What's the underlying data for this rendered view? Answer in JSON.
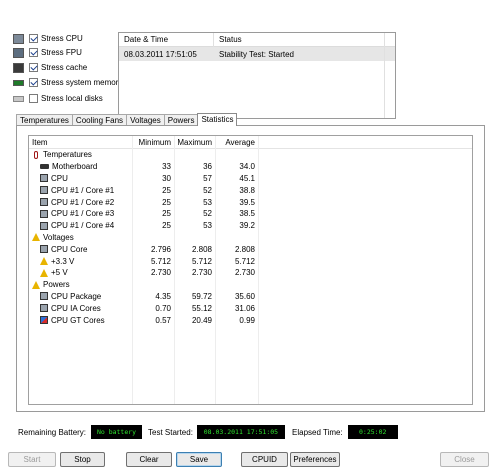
{
  "options": [
    {
      "icon": "cpu-chip-icon",
      "label": "Stress CPU",
      "checked": true
    },
    {
      "icon": "fpu-chip-icon",
      "label": "Stress FPU",
      "checked": true
    },
    {
      "icon": "cache-icon",
      "label": "Stress cache",
      "checked": true
    },
    {
      "icon": "memory-icon",
      "label": "Stress system memory",
      "checked": true
    },
    {
      "icon": "disk-icon",
      "label": "Stress local disks",
      "checked": false
    }
  ],
  "log": {
    "headers": {
      "datetime": "Date & Time",
      "status": "Status"
    },
    "rows": [
      {
        "datetime": "08.03.2011 17:51:05",
        "status": "Stability Test: Started"
      }
    ]
  },
  "tabs": [
    "Temperatures",
    "Cooling Fans",
    "Voltages",
    "Powers",
    "Statistics"
  ],
  "active_tab": "Statistics",
  "stats": {
    "headers": {
      "item": "Item",
      "min": "Minimum",
      "max": "Maximum",
      "avg": "Average"
    },
    "rows": [
      {
        "type": "group",
        "icon": "thermometer-icon",
        "label": "Temperatures"
      },
      {
        "type": "item",
        "icon": "motherboard-icon",
        "label": "Motherboard",
        "min": "33",
        "max": "36",
        "avg": "34.0"
      },
      {
        "type": "item",
        "icon": "cpu-chip-icon",
        "label": "CPU",
        "min": "30",
        "max": "57",
        "avg": "45.1"
      },
      {
        "type": "item",
        "icon": "cpu-chip-icon",
        "label": "CPU #1 / Core #1",
        "min": "25",
        "max": "52",
        "avg": "38.8"
      },
      {
        "type": "item",
        "icon": "cpu-chip-icon",
        "label": "CPU #1 / Core #2",
        "min": "25",
        "max": "53",
        "avg": "39.5"
      },
      {
        "type": "item",
        "icon": "cpu-chip-icon",
        "label": "CPU #1 / Core #3",
        "min": "25",
        "max": "52",
        "avg": "38.5"
      },
      {
        "type": "item",
        "icon": "cpu-chip-icon",
        "label": "CPU #1 / Core #4",
        "min": "25",
        "max": "53",
        "avg": "39.2"
      },
      {
        "type": "group",
        "icon": "warning-icon",
        "label": "Voltages"
      },
      {
        "type": "item",
        "icon": "cpu-chip-icon",
        "label": "CPU Core",
        "min": "2.796",
        "max": "2.808",
        "avg": "2.808"
      },
      {
        "type": "item",
        "icon": "warning-icon",
        "label": "+3.3 V",
        "min": "5.712",
        "max": "5.712",
        "avg": "5.712"
      },
      {
        "type": "item",
        "icon": "warning-icon",
        "label": "+5 V",
        "min": "2.730",
        "max": "2.730",
        "avg": "2.730"
      },
      {
        "type": "group",
        "icon": "warning-icon",
        "label": "Powers"
      },
      {
        "type": "item",
        "icon": "cpu-chip-icon",
        "label": "CPU Package",
        "min": "4.35",
        "max": "59.72",
        "avg": "35.60"
      },
      {
        "type": "item",
        "icon": "cpu-chip-icon",
        "label": "CPU IA Cores",
        "min": "0.70",
        "max": "55.12",
        "avg": "31.06"
      },
      {
        "type": "item",
        "icon": "gpu-icon",
        "label": "CPU GT Cores",
        "min": "0.57",
        "max": "20.49",
        "avg": "0.99"
      }
    ]
  },
  "status_bar": {
    "battery_label": "Remaining Battery:",
    "battery_value": "No battery",
    "started_label": "Test Started:",
    "started_value": "08.03.2011 17:51:05",
    "elapsed_label": "Elapsed Time:",
    "elapsed_value": "0:25:02"
  },
  "buttons": {
    "start": "Start",
    "stop": "Stop",
    "clear": "Clear",
    "save": "Save",
    "cpuid": "CPUID",
    "preferences": "Preferences",
    "close": "Close"
  },
  "colors": {
    "lcd_text": "#2fe32f",
    "lcd_bg": "#000000",
    "warning": "#e8b400"
  }
}
